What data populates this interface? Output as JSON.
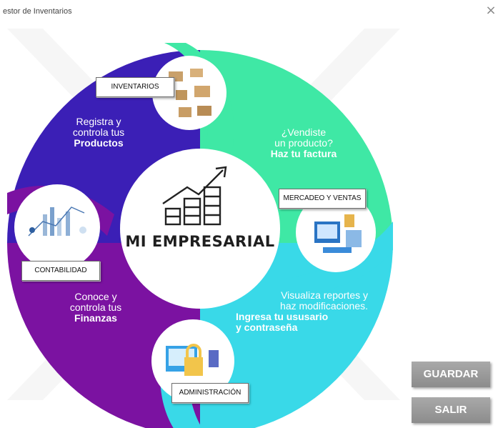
{
  "window": {
    "title": "estor de Inventarios",
    "close_label": "×"
  },
  "center": {
    "brand": "MI EMPRESARIAL"
  },
  "segments": [
    {
      "id": "inventarios",
      "button_label": "INVENTARIOS",
      "text_line1": "Registra y",
      "text_line2": "controla tus",
      "text_bold1": "Productos",
      "color": "#3b1fb6"
    },
    {
      "id": "ventas",
      "button_label": "MERCADEO Y VENTAS",
      "text_line1": "¿Vendiste",
      "text_line2": "un producto?",
      "text_bold1": "Haz tu factura",
      "color": "#3fe8a5"
    },
    {
      "id": "administracion",
      "button_label": "ADMINISTRACIÓN",
      "text_line1": "Visualiza reportes y",
      "text_line2": "haz modificaciones.",
      "text_bold1": "Ingresa tu ususario",
      "text_bold2": "y contraseña",
      "color": "#39d9e8"
    },
    {
      "id": "contabilidad",
      "button_label": "CONTABILIDAD",
      "text_line1": "Conoce y",
      "text_line2": "controla tus",
      "text_bold1": "Finanzas",
      "color": "#7b12a1"
    }
  ],
  "actions": {
    "save_label": "GUARDAR",
    "exit_label": "SALIR"
  }
}
